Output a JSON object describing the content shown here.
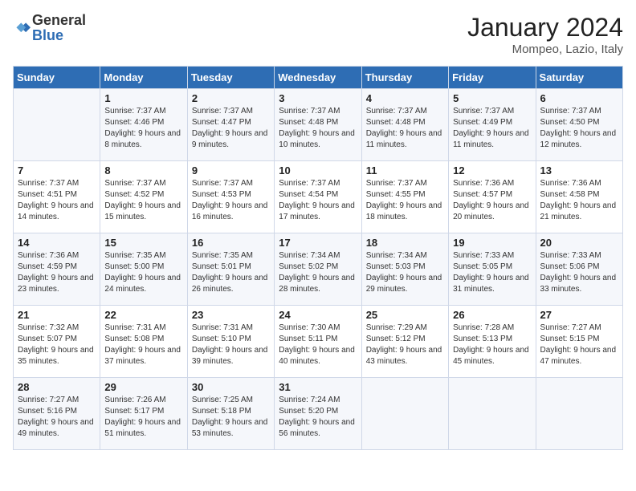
{
  "header": {
    "logo_general": "General",
    "logo_blue": "Blue",
    "month": "January 2024",
    "location": "Mompeo, Lazio, Italy"
  },
  "weekdays": [
    "Sunday",
    "Monday",
    "Tuesday",
    "Wednesday",
    "Thursday",
    "Friday",
    "Saturday"
  ],
  "weeks": [
    [
      {
        "day": "",
        "sunrise": "",
        "sunset": "",
        "daylight": ""
      },
      {
        "day": "1",
        "sunrise": "Sunrise: 7:37 AM",
        "sunset": "Sunset: 4:46 PM",
        "daylight": "Daylight: 9 hours and 8 minutes."
      },
      {
        "day": "2",
        "sunrise": "Sunrise: 7:37 AM",
        "sunset": "Sunset: 4:47 PM",
        "daylight": "Daylight: 9 hours and 9 minutes."
      },
      {
        "day": "3",
        "sunrise": "Sunrise: 7:37 AM",
        "sunset": "Sunset: 4:48 PM",
        "daylight": "Daylight: 9 hours and 10 minutes."
      },
      {
        "day": "4",
        "sunrise": "Sunrise: 7:37 AM",
        "sunset": "Sunset: 4:48 PM",
        "daylight": "Daylight: 9 hours and 11 minutes."
      },
      {
        "day": "5",
        "sunrise": "Sunrise: 7:37 AM",
        "sunset": "Sunset: 4:49 PM",
        "daylight": "Daylight: 9 hours and 11 minutes."
      },
      {
        "day": "6",
        "sunrise": "Sunrise: 7:37 AM",
        "sunset": "Sunset: 4:50 PM",
        "daylight": "Daylight: 9 hours and 12 minutes."
      }
    ],
    [
      {
        "day": "7",
        "sunrise": "Sunrise: 7:37 AM",
        "sunset": "Sunset: 4:51 PM",
        "daylight": "Daylight: 9 hours and 14 minutes."
      },
      {
        "day": "8",
        "sunrise": "Sunrise: 7:37 AM",
        "sunset": "Sunset: 4:52 PM",
        "daylight": "Daylight: 9 hours and 15 minutes."
      },
      {
        "day": "9",
        "sunrise": "Sunrise: 7:37 AM",
        "sunset": "Sunset: 4:53 PM",
        "daylight": "Daylight: 9 hours and 16 minutes."
      },
      {
        "day": "10",
        "sunrise": "Sunrise: 7:37 AM",
        "sunset": "Sunset: 4:54 PM",
        "daylight": "Daylight: 9 hours and 17 minutes."
      },
      {
        "day": "11",
        "sunrise": "Sunrise: 7:37 AM",
        "sunset": "Sunset: 4:55 PM",
        "daylight": "Daylight: 9 hours and 18 minutes."
      },
      {
        "day": "12",
        "sunrise": "Sunrise: 7:36 AM",
        "sunset": "Sunset: 4:57 PM",
        "daylight": "Daylight: 9 hours and 20 minutes."
      },
      {
        "day": "13",
        "sunrise": "Sunrise: 7:36 AM",
        "sunset": "Sunset: 4:58 PM",
        "daylight": "Daylight: 9 hours and 21 minutes."
      }
    ],
    [
      {
        "day": "14",
        "sunrise": "Sunrise: 7:36 AM",
        "sunset": "Sunset: 4:59 PM",
        "daylight": "Daylight: 9 hours and 23 minutes."
      },
      {
        "day": "15",
        "sunrise": "Sunrise: 7:35 AM",
        "sunset": "Sunset: 5:00 PM",
        "daylight": "Daylight: 9 hours and 24 minutes."
      },
      {
        "day": "16",
        "sunrise": "Sunrise: 7:35 AM",
        "sunset": "Sunset: 5:01 PM",
        "daylight": "Daylight: 9 hours and 26 minutes."
      },
      {
        "day": "17",
        "sunrise": "Sunrise: 7:34 AM",
        "sunset": "Sunset: 5:02 PM",
        "daylight": "Daylight: 9 hours and 28 minutes."
      },
      {
        "day": "18",
        "sunrise": "Sunrise: 7:34 AM",
        "sunset": "Sunset: 5:03 PM",
        "daylight": "Daylight: 9 hours and 29 minutes."
      },
      {
        "day": "19",
        "sunrise": "Sunrise: 7:33 AM",
        "sunset": "Sunset: 5:05 PM",
        "daylight": "Daylight: 9 hours and 31 minutes."
      },
      {
        "day": "20",
        "sunrise": "Sunrise: 7:33 AM",
        "sunset": "Sunset: 5:06 PM",
        "daylight": "Daylight: 9 hours and 33 minutes."
      }
    ],
    [
      {
        "day": "21",
        "sunrise": "Sunrise: 7:32 AM",
        "sunset": "Sunset: 5:07 PM",
        "daylight": "Daylight: 9 hours and 35 minutes."
      },
      {
        "day": "22",
        "sunrise": "Sunrise: 7:31 AM",
        "sunset": "Sunset: 5:08 PM",
        "daylight": "Daylight: 9 hours and 37 minutes."
      },
      {
        "day": "23",
        "sunrise": "Sunrise: 7:31 AM",
        "sunset": "Sunset: 5:10 PM",
        "daylight": "Daylight: 9 hours and 39 minutes."
      },
      {
        "day": "24",
        "sunrise": "Sunrise: 7:30 AM",
        "sunset": "Sunset: 5:11 PM",
        "daylight": "Daylight: 9 hours and 40 minutes."
      },
      {
        "day": "25",
        "sunrise": "Sunrise: 7:29 AM",
        "sunset": "Sunset: 5:12 PM",
        "daylight": "Daylight: 9 hours and 43 minutes."
      },
      {
        "day": "26",
        "sunrise": "Sunrise: 7:28 AM",
        "sunset": "Sunset: 5:13 PM",
        "daylight": "Daylight: 9 hours and 45 minutes."
      },
      {
        "day": "27",
        "sunrise": "Sunrise: 7:27 AM",
        "sunset": "Sunset: 5:15 PM",
        "daylight": "Daylight: 9 hours and 47 minutes."
      }
    ],
    [
      {
        "day": "28",
        "sunrise": "Sunrise: 7:27 AM",
        "sunset": "Sunset: 5:16 PM",
        "daylight": "Daylight: 9 hours and 49 minutes."
      },
      {
        "day": "29",
        "sunrise": "Sunrise: 7:26 AM",
        "sunset": "Sunset: 5:17 PM",
        "daylight": "Daylight: 9 hours and 51 minutes."
      },
      {
        "day": "30",
        "sunrise": "Sunrise: 7:25 AM",
        "sunset": "Sunset: 5:18 PM",
        "daylight": "Daylight: 9 hours and 53 minutes."
      },
      {
        "day": "31",
        "sunrise": "Sunrise: 7:24 AM",
        "sunset": "Sunset: 5:20 PM",
        "daylight": "Daylight: 9 hours and 56 minutes."
      },
      {
        "day": "",
        "sunrise": "",
        "sunset": "",
        "daylight": ""
      },
      {
        "day": "",
        "sunrise": "",
        "sunset": "",
        "daylight": ""
      },
      {
        "day": "",
        "sunrise": "",
        "sunset": "",
        "daylight": ""
      }
    ]
  ]
}
